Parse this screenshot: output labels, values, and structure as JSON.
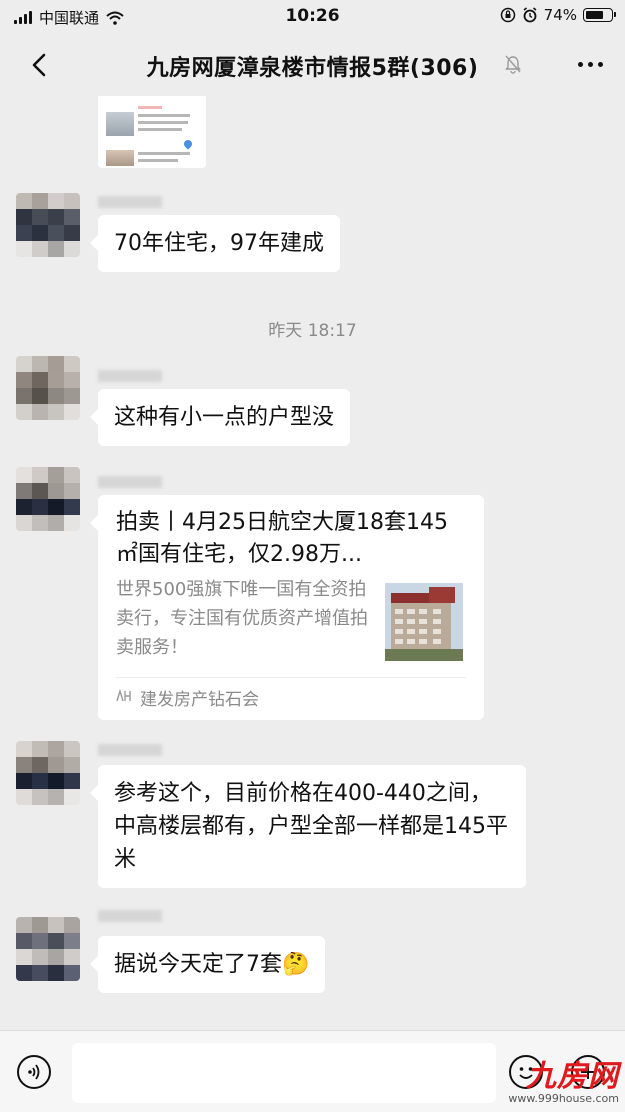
{
  "status_bar": {
    "carrier": "中国联通",
    "time": "10:26",
    "battery": "74%",
    "battery_level": 0.74
  },
  "nav": {
    "title": "九房网厦漳泉楼市情报5群(306)",
    "icons": [
      "back-icon",
      "mute-icon",
      "more-icon"
    ]
  },
  "time_separator": "昨天 18:17",
  "messages": [
    {
      "type": "text",
      "text": "70年住宅，97年建成"
    },
    {
      "type": "text",
      "text": "这种有小一点的户型没"
    },
    {
      "type": "link",
      "title": "拍卖丨4月25日航空大厦18套145㎡国有住宅，仅2.98万...",
      "description": "世界500强旗下唯一国有全资拍卖行，专注国有优质资产增值拍卖服务！",
      "source": "建发房产钻石会"
    },
    {
      "type": "text",
      "text": "参考这个，目前价格在400-440之间，中高楼层都有，户型全部一样都是145平米"
    },
    {
      "type": "text",
      "text": "据说今天定了7套"
    }
  ],
  "emoji": "🤔",
  "watermark": {
    "logo": "九房网",
    "url": "www.999house.com"
  },
  "colors": {
    "background": "#ededed",
    "bubble": "#ffffff",
    "watermark_red": "#e0191d",
    "muted_text": "#8a8a8a"
  }
}
